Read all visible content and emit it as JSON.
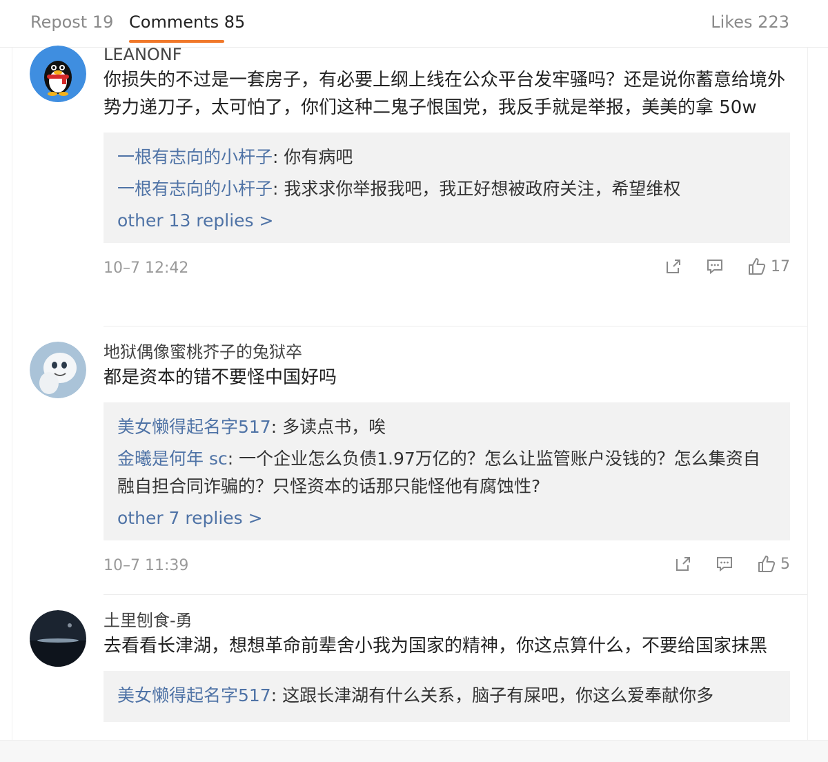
{
  "tabs": {
    "repost": "Repost 19",
    "comments": "Comments 85",
    "likes": "Likes 223"
  },
  "comments": [
    {
      "author": "LEANONF",
      "text": "你损失的不过是一套房子，有必要上纲上线在公众平台发牢骚吗？还是说你蓄意给境外势力递刀子，太可怕了，你们这种二鬼子恨国党，我反手就是举报，美美的拿 50w",
      "replies": [
        {
          "name": "一根有志向的小杆子",
          "text": ": 你有病吧"
        },
        {
          "name": "一根有志向的小杆子",
          "text": ": 我求求你举报我吧，我正好想被政府关注，希望维权"
        }
      ],
      "more": "other 13 replies >",
      "time": "10–7 12:42",
      "likes": "17",
      "avatar": "qq-penguin-avatar"
    },
    {
      "author": "地狱偶像蜜桃芥子的兔狱卒",
      "text": "都是资本的错不要怪中国好吗",
      "replies": [
        {
          "name": "美女懒得起名字517",
          "text": ": 多读点书，唉"
        },
        {
          "name": "金曦是何年 sc",
          "text": ": 一个企业怎么负债1.97万亿的？怎么让监管账户没钱的？怎么集资自融自担合同诈骗的？只怪资本的话那只能怪他有腐蚀性?"
        }
      ],
      "more": "other 7 replies >",
      "time": "10–7 11:39",
      "likes": "5",
      "avatar": "ghost-avatar"
    },
    {
      "author": "土里刨食-勇",
      "text": "去看看长津湖，想想革命前辈舍小我为国家的精神，你这点算什么，不要给国家抹黑",
      "replies": [
        {
          "name": "美女懒得起名字517",
          "text": ": 这跟长津湖有什么关系，脑子有屎吧，你这么爱奉献你多"
        }
      ],
      "avatar": "night-landscape-avatar"
    }
  ],
  "colors": {
    "accent": "#f0782a",
    "link": "#4f73a6"
  }
}
